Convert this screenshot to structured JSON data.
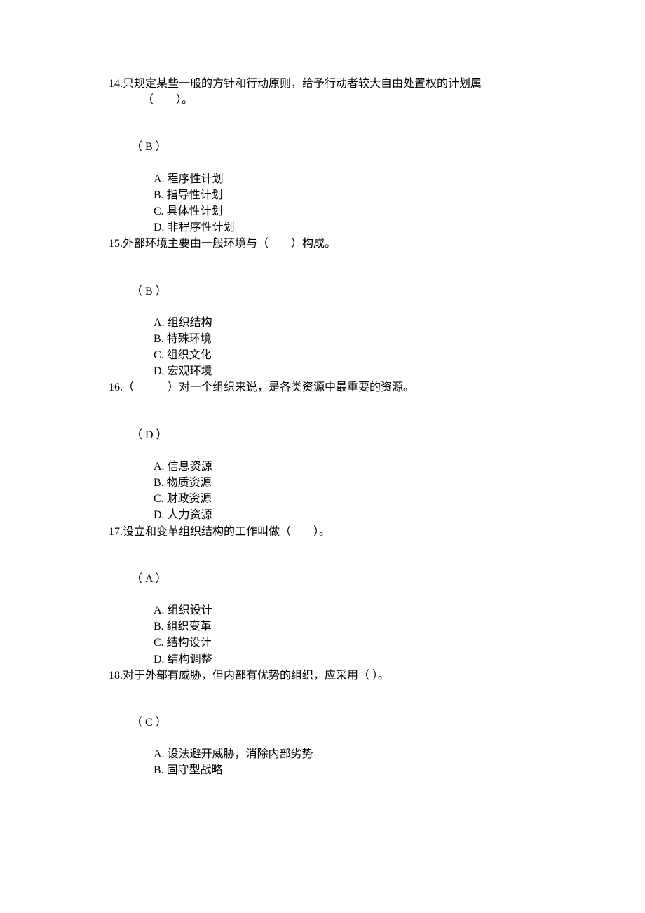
{
  "questions": [
    {
      "number": "14.",
      "stem": "只规定某些一般的方针和行动原则，给予行动者较大自由处置权的计划属",
      "continuation": "（　　）。",
      "answer": "（ B ）",
      "options": [
        {
          "label": "A. ",
          "text": "程序性计划"
        },
        {
          "label": "B. ",
          "text": "指导性计划"
        },
        {
          "label": "C. ",
          "text": "具体性计划"
        },
        {
          "label": "D. ",
          "text": "非程序性计划"
        }
      ]
    },
    {
      "number": "15.",
      "stem": "外部环境主要由一般环境与（　　）构成。",
      "continuation": "",
      "answer": "（ B ）",
      "options": [
        {
          "label": "A. ",
          "text": "组织结构"
        },
        {
          "label": "B. ",
          "text": "特殊环境"
        },
        {
          "label": "C. ",
          "text": "组织文化"
        },
        {
          "label": "D. ",
          "text": "宏观环境"
        }
      ]
    },
    {
      "number": "16.",
      "stem": "（　　　）对一个组织来说，是各类资源中最重要的资源。",
      "continuation": "",
      "answer": "（ D ）",
      "options": [
        {
          "label": "A. ",
          "text": "信息资源"
        },
        {
          "label": "B. ",
          "text": "物质资源"
        },
        {
          "label": "C. ",
          "text": "财政资源"
        },
        {
          "label": "D. ",
          "text": "人力资源"
        }
      ]
    },
    {
      "number": "17.",
      "stem": "设立和变革组织结构的工作叫做（　　）。",
      "continuation": "",
      "answer": "（ A ）",
      "options": [
        {
          "label": "A. ",
          "text": "组织设计"
        },
        {
          "label": "B. ",
          "text": "组织变革"
        },
        {
          "label": "C. ",
          "text": "结构设计"
        },
        {
          "label": "D. ",
          "text": "结构调整"
        }
      ]
    },
    {
      "number": "18.",
      "stem": "对于外部有威胁，但内部有优势的组织，应采用（ ）。",
      "continuation": "",
      "answer": "（ C ）",
      "options": [
        {
          "label": "A. ",
          "text": "设法避开威胁，消除内部劣势"
        },
        {
          "label": "B. ",
          "text": "固守型战略"
        }
      ]
    }
  ]
}
